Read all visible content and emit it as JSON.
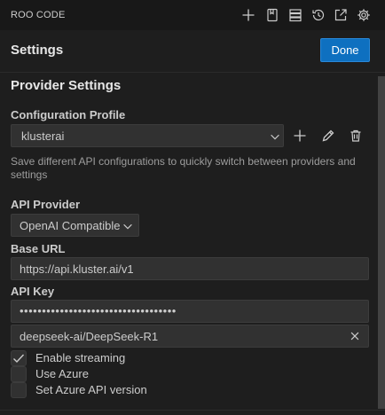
{
  "header": {
    "app_title": "ROO CODE",
    "icons": [
      "plus-icon",
      "history-book-icon",
      "server-stack-icon",
      "history-icon",
      "open-external-icon",
      "gear-icon"
    ]
  },
  "settings": {
    "title": "Settings",
    "done_label": "Done"
  },
  "provider_settings": {
    "section_title": "Provider Settings",
    "config_profile_label": "Configuration Profile",
    "config_profile_value": "klusterai",
    "config_profile_help": "Save different API configurations to quickly switch between providers and settings",
    "api_provider_label": "API Provider",
    "api_provider_value": "OpenAI Compatible",
    "base_url_label": "Base URL",
    "base_url_value": "https://api.kluster.ai/v1",
    "api_key_label": "API Key",
    "api_key_value": "•••••••••••••••••••••••••••••••••••",
    "model_value": "deepseek-ai/DeepSeek-R1"
  },
  "checkboxes": [
    {
      "label": "Enable streaming",
      "checked": true
    },
    {
      "label": "Use Azure",
      "checked": false
    },
    {
      "label": "Set Azure API version",
      "checked": false
    }
  ],
  "colors": {
    "background": "#1e1e1e",
    "accent": "#0e70c0",
    "input_bg": "#313131",
    "text": "#cccccc"
  }
}
